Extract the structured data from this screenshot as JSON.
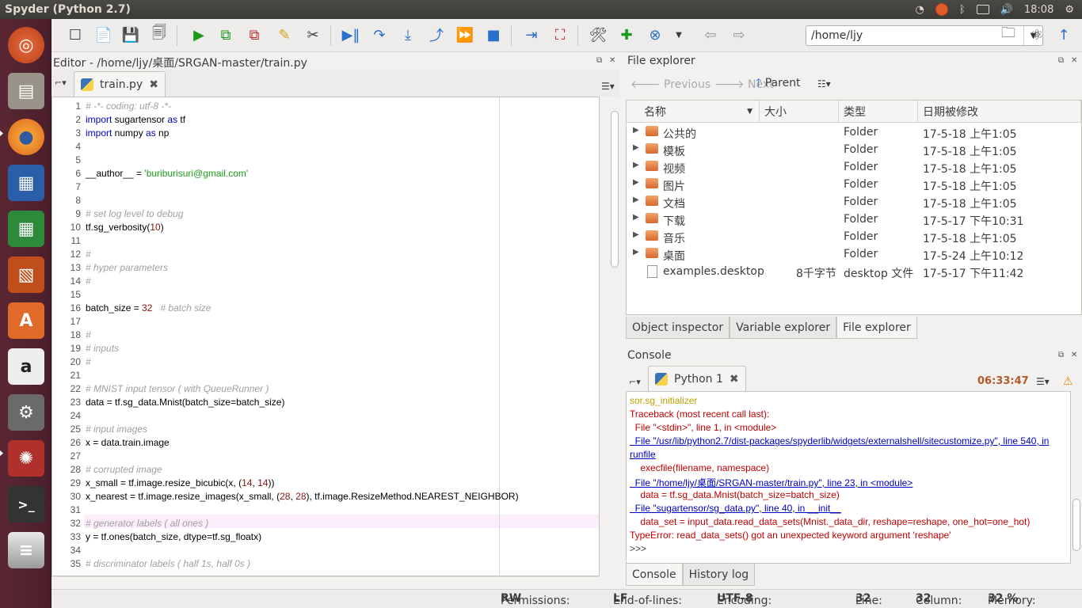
{
  "window": {
    "title": "Spyder (Python 2.7)"
  },
  "tray": {
    "time": "18:08"
  },
  "toolbar": {
    "path": "/home/ljy"
  },
  "editor": {
    "title": "Editor - /home/ljy/桌面/SRGAN-master/train.py",
    "tab_label": "train.py",
    "lines": [
      {
        "n": "1",
        "segs": [
          [
            "c",
            "# -*- coding: utf-8 -*-"
          ]
        ]
      },
      {
        "n": "2",
        "segs": [
          [
            "k",
            "import"
          ],
          [
            "t",
            " sugartensor "
          ],
          [
            "k",
            "as"
          ],
          [
            "t",
            " tf"
          ]
        ]
      },
      {
        "n": "3",
        "segs": [
          [
            "k",
            "import"
          ],
          [
            "t",
            " numpy "
          ],
          [
            "k",
            "as"
          ],
          [
            "t",
            " np"
          ]
        ]
      },
      {
        "n": "4",
        "segs": []
      },
      {
        "n": "5",
        "segs": []
      },
      {
        "n": "6",
        "segs": [
          [
            "t",
            "__author__ = "
          ],
          [
            "s",
            "'buriburisuri@gmail.com'"
          ]
        ]
      },
      {
        "n": "7",
        "segs": []
      },
      {
        "n": "8",
        "segs": []
      },
      {
        "n": "9",
        "segs": [
          [
            "c",
            "# set log level to debug"
          ]
        ]
      },
      {
        "n": "10",
        "segs": [
          [
            "t",
            "tf.sg_verbosity("
          ],
          [
            "n",
            "10"
          ],
          [
            "t",
            ")"
          ]
        ]
      },
      {
        "n": "11",
        "segs": []
      },
      {
        "n": "12",
        "segs": [
          [
            "c",
            "#"
          ]
        ]
      },
      {
        "n": "13",
        "segs": [
          [
            "c",
            "# hyper parameters"
          ]
        ]
      },
      {
        "n": "14",
        "segs": [
          [
            "c",
            "#"
          ]
        ]
      },
      {
        "n": "15",
        "segs": []
      },
      {
        "n": "16",
        "segs": [
          [
            "t",
            "batch_size = "
          ],
          [
            "n",
            "32"
          ],
          [
            "t",
            "   "
          ],
          [
            "c",
            "# batch size"
          ]
        ]
      },
      {
        "n": "17",
        "segs": []
      },
      {
        "n": "18",
        "segs": [
          [
            "c",
            "#"
          ]
        ]
      },
      {
        "n": "19",
        "segs": [
          [
            "c",
            "# inputs"
          ]
        ]
      },
      {
        "n": "20",
        "segs": [
          [
            "c",
            "#"
          ]
        ]
      },
      {
        "n": "21",
        "segs": []
      },
      {
        "n": "22",
        "segs": [
          [
            "c",
            "# MNIST input tensor ( with QueueRunner )"
          ]
        ]
      },
      {
        "n": "23",
        "segs": [
          [
            "t",
            "data = tf.sg_data.Mnist(batch_size=batch_size)"
          ]
        ]
      },
      {
        "n": "24",
        "segs": []
      },
      {
        "n": "25",
        "segs": [
          [
            "c",
            "# input images"
          ]
        ]
      },
      {
        "n": "26",
        "segs": [
          [
            "t",
            "x = data.train.image"
          ]
        ]
      },
      {
        "n": "27",
        "segs": []
      },
      {
        "n": "28",
        "segs": [
          [
            "c",
            "# corrupted image"
          ]
        ]
      },
      {
        "n": "29",
        "segs": [
          [
            "t",
            "x_small = tf.image.resize_bicubic(x, ("
          ],
          [
            "n",
            "14"
          ],
          [
            "t",
            ", "
          ],
          [
            "n",
            "14"
          ],
          [
            "t",
            "))"
          ]
        ]
      },
      {
        "n": "30",
        "segs": [
          [
            "t",
            "x_nearest = tf.image.resize_images(x_small, ("
          ],
          [
            "n",
            "28"
          ],
          [
            "t",
            ", "
          ],
          [
            "n",
            "28"
          ],
          [
            "t",
            "), tf.image.ResizeMethod.NEAREST_NEIGHBOR)"
          ]
        ]
      },
      {
        "n": "31",
        "segs": []
      },
      {
        "n": "32",
        "segs": [
          [
            "c",
            "# generator labels ( all ones )"
          ]
        ]
      },
      {
        "n": "33",
        "segs": [
          [
            "t",
            "y = tf.ones(batch_size, dtype=tf.sg_floatx)"
          ]
        ]
      },
      {
        "n": "34",
        "segs": []
      },
      {
        "n": "35",
        "segs": [
          [
            "c",
            "# discriminator labels ( half 1s, half 0s )"
          ]
        ]
      }
    ]
  },
  "file_explorer": {
    "title": "File explorer",
    "nav": {
      "previous": "Previous",
      "next": "Next",
      "parent": "Parent"
    },
    "columns": [
      "名称",
      "大小",
      "类型",
      "日期被修改"
    ],
    "rows": [
      {
        "name": "公共的",
        "size": "",
        "type": "Folder",
        "date": "17-5-18 上午1:05",
        "kind": "folder"
      },
      {
        "name": "模板",
        "size": "",
        "type": "Folder",
        "date": "17-5-18 上午1:05",
        "kind": "folder"
      },
      {
        "name": "视频",
        "size": "",
        "type": "Folder",
        "date": "17-5-18 上午1:05",
        "kind": "folder"
      },
      {
        "name": "图片",
        "size": "",
        "type": "Folder",
        "date": "17-5-18 上午1:05",
        "kind": "folder"
      },
      {
        "name": "文档",
        "size": "",
        "type": "Folder",
        "date": "17-5-18 上午1:05",
        "kind": "folder"
      },
      {
        "name": "下载",
        "size": "",
        "type": "Folder",
        "date": "17-5-17 下午10:31",
        "kind": "folder"
      },
      {
        "name": "音乐",
        "size": "",
        "type": "Folder",
        "date": "17-5-18 上午1:05",
        "kind": "folder"
      },
      {
        "name": "桌面",
        "size": "",
        "type": "Folder",
        "date": "17-5-24 上午10:12",
        "kind": "folder"
      },
      {
        "name": "examples.desktop",
        "size": "8千字节",
        "type": "desktop 文件",
        "date": "17-5-17 下午11:42",
        "kind": "file"
      }
    ],
    "tabs": [
      "Object inspector",
      "Variable explorer",
      "File explorer"
    ]
  },
  "console": {
    "title": "Console",
    "tab_label": "Python 1",
    "elapsed": "06:33:47",
    "lines": [
      {
        "cls": "warn",
        "text": "sor.sg_initializer"
      },
      {
        "cls": "err",
        "text": "Traceback (most recent call last):"
      },
      {
        "cls": "err",
        "text": "  File \"<stdin>\", line 1, in <module>"
      },
      {
        "cls": "lnk",
        "text": "  File \"/usr/lib/python2.7/dist-packages/spyderlib/widgets/externalshell/sitecustomize.py\", line 540, in"
      },
      {
        "cls": "lnk",
        "text": "runfile"
      },
      {
        "cls": "err",
        "text": "    execfile(filename, namespace)"
      },
      {
        "cls": "lnk",
        "text": "  File \"/home/ljy/桌面/SRGAN-master/train.py\", line 23, in <module>"
      },
      {
        "cls": "err",
        "text": "    data = tf.sg_data.Mnist(batch_size=batch_size)"
      },
      {
        "cls": "lnk",
        "text": "  File \"sugartensor/sg_data.py\", line 40, in __init__"
      },
      {
        "cls": "err",
        "text": "    data_set = input_data.read_data_sets(Mnist._data_dir, reshape=reshape, one_hot=one_hot)"
      },
      {
        "cls": "err",
        "text": "TypeError: read_data_sets() got an unexpected keyword argument 'reshape'"
      },
      {
        "cls": "",
        "text": ">>> "
      }
    ],
    "tabs": [
      "Console",
      "History log"
    ]
  },
  "status": {
    "permissions_label": "Permissions:",
    "permissions": "RW",
    "eol_label": "End-of-lines:",
    "eol": "LF",
    "encoding_label": "Encoding:",
    "encoding": "UTF-8",
    "line_label": "Line:",
    "line": "32",
    "column_label": "Column:",
    "column": "32",
    "memory_label": "Memory:",
    "memory": "32 %"
  },
  "colors": {
    "accent": "#2a6fc9",
    "launcher": "#4a1f2b",
    "error": "#c00000"
  }
}
